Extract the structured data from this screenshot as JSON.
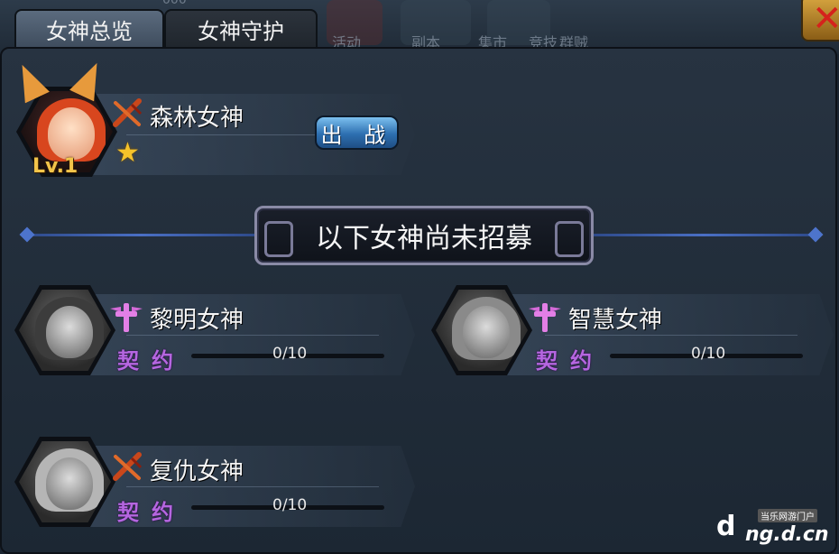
{
  "tabs": [
    {
      "label": "女神总览",
      "active": true
    },
    {
      "label": "女神守护",
      "active": false
    }
  ],
  "background_texts": [
    "000",
    "活动",
    "副本",
    "集市",
    "竞技",
    "群贼"
  ],
  "recruited": [
    {
      "name": "森林女神",
      "level": "Lv.1",
      "class_icon": "sword-class-icon",
      "stars": 1,
      "deploy_label": "出 战"
    }
  ],
  "divider_banner": "以下女神尚未招募",
  "unrecruited": [
    {
      "name": "黎明女神",
      "class_icon": "cross-wing-class-icon",
      "contract_label": "契约",
      "progress": "0/10"
    },
    {
      "name": "智慧女神",
      "class_icon": "cross-wing-class-icon",
      "contract_label": "契约",
      "progress": "0/10"
    },
    {
      "name": "复仇女神",
      "class_icon": "sword-class-icon",
      "contract_label": "契约",
      "progress": "0/10"
    }
  ],
  "watermark": {
    "tag": "当乐网游门户",
    "url": "ng.d.cn"
  },
  "colors": {
    "accent_purple": "#b566e0",
    "star_gold": "#f5c22a",
    "deploy_blue": "#2d6fb0",
    "close_red": "#d5221c"
  }
}
